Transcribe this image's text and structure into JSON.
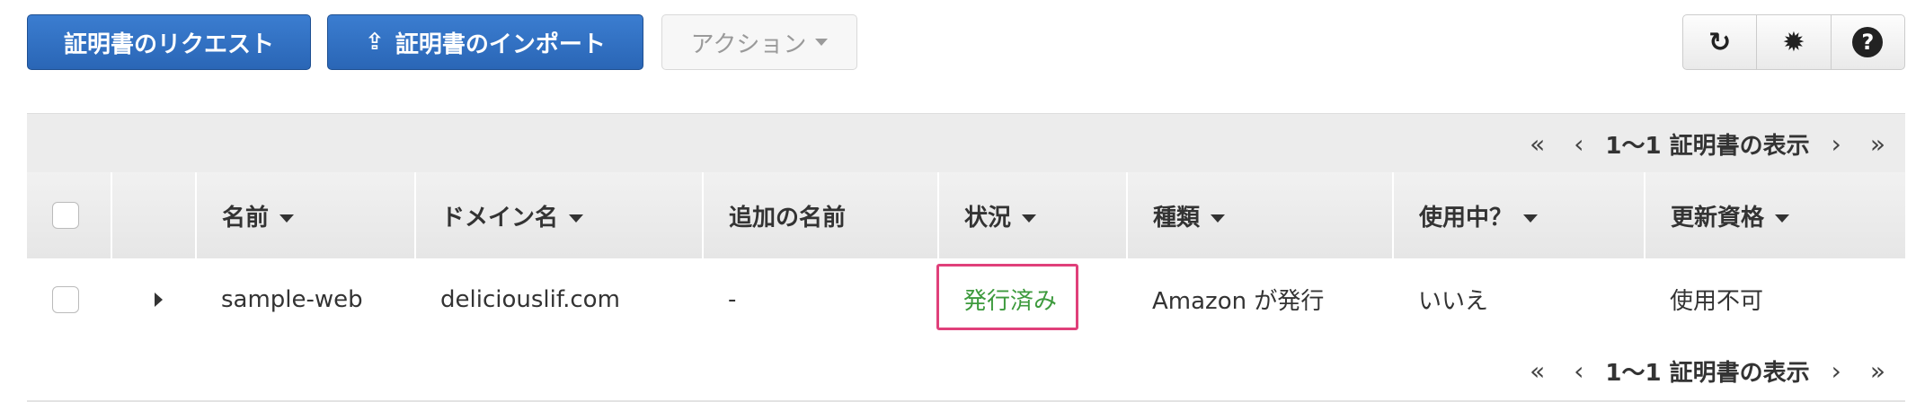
{
  "toolbar": {
    "request_label": "証明書のリクエスト",
    "import_label": "証明書のインポート",
    "actions_label": "アクション",
    "refresh_icon": "↻",
    "settings_icon": "✹",
    "help_icon": "?"
  },
  "pager": {
    "first": "«",
    "prev": "‹",
    "count": "1〜1 証明書の表示",
    "next": "›",
    "last": "»"
  },
  "table": {
    "columns": {
      "name": "名前",
      "domain": "ドメイン名",
      "additional": "追加の名前",
      "status": "状況",
      "type": "種類",
      "in_use": "使用中？",
      "renewal": "更新資格"
    },
    "rows": [
      {
        "name": "sample-web",
        "domain": "deliciouslif.com",
        "additional": "-",
        "status": "発行済み",
        "type": "Amazon が発行",
        "in_use": "いいえ",
        "renewal": "使用不可"
      }
    ]
  },
  "colors": {
    "primary": "#2a66b6",
    "status_issued": "#3d9a3d",
    "highlight": "#e0407a"
  }
}
